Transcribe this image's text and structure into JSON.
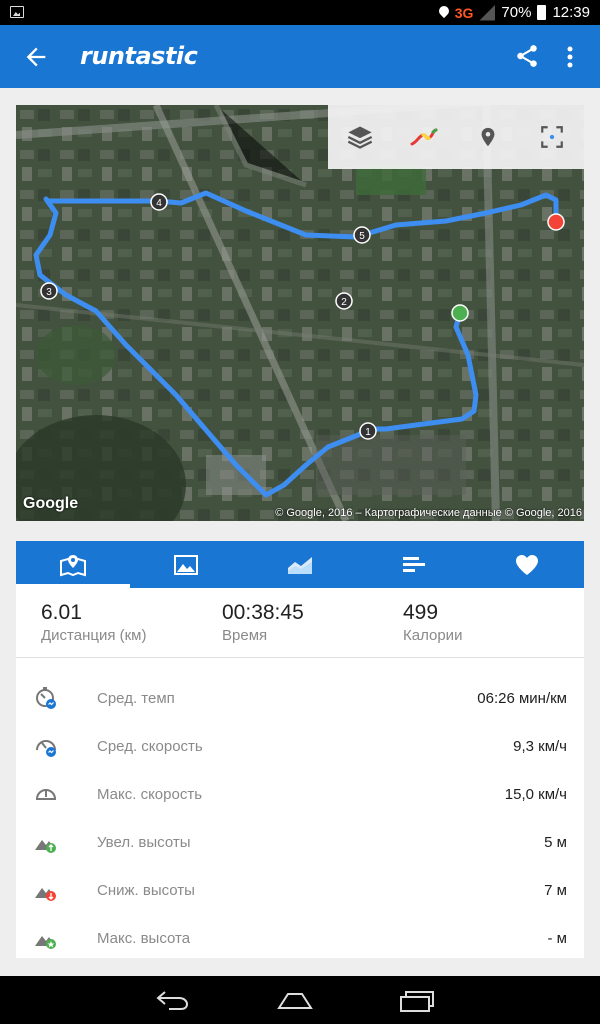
{
  "status_bar": {
    "network": "3G",
    "battery": "70%",
    "time": "12:39"
  },
  "app_bar": {
    "logo": "runtastic",
    "icons": [
      "back-arrow-icon",
      "share-icon",
      "more-vert-icon"
    ]
  },
  "map": {
    "tools": [
      "layers-icon",
      "heatmap-route-icon",
      "location-pin-icon",
      "fullscreen-icon"
    ],
    "google_logo": "Google",
    "attribution": "© Google, 2016 – Картографические данные © Google, 2016",
    "km_markers": [
      "1",
      "2",
      "3",
      "4",
      "5"
    ],
    "route_color": "#3d8ef0",
    "start_color": "#4caf50",
    "end_color": "#f44336"
  },
  "tabs": {
    "items": [
      "map-tab-icon",
      "photo-tab-icon",
      "chart-tab-icon",
      "splits-tab-icon",
      "heart-tab-icon"
    ],
    "active": 0
  },
  "summary": {
    "distance_value": "6.01",
    "distance_label": "Дистанция (км)",
    "time_value": "00:38:45",
    "time_label": "Время",
    "calories_value": "499",
    "calories_label": "Калории"
  },
  "stats": [
    {
      "label": "Сред. темп",
      "value": "06:26 мин/км",
      "icon": "avg-pace-icon"
    },
    {
      "label": "Сред. скорость",
      "value": "9,3 км/ч",
      "icon": "avg-speed-icon"
    },
    {
      "label": "Макс. скорость",
      "value": "15,0 км/ч",
      "icon": "max-speed-icon"
    },
    {
      "label": "Увел. высоты",
      "value": "5 м",
      "icon": "elevation-gain-icon"
    },
    {
      "label": "Сниж. высоты",
      "value": "7 м",
      "icon": "elevation-loss-icon"
    },
    {
      "label": "Макс. высота",
      "value": "- м",
      "icon": "max-elevation-icon"
    }
  ],
  "colors": {
    "primary": "#1976d2",
    "background": "#eeeeee"
  }
}
